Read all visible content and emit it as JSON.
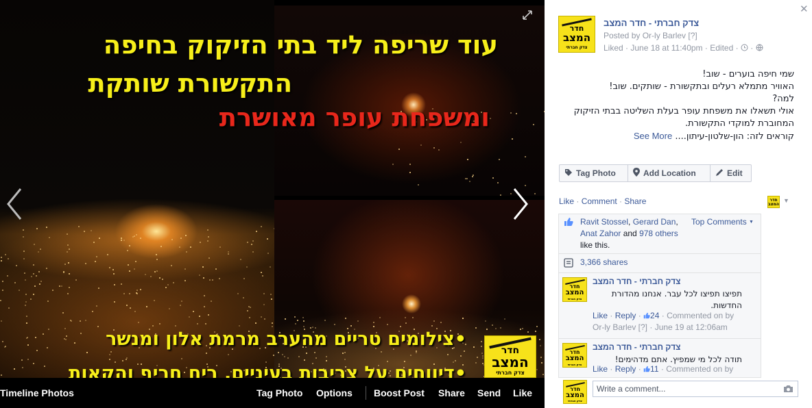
{
  "photo": {
    "overlay_line1": "עוד שריפה ליד בתי הזיקוק בחיפה",
    "overlay_line2": "התקשורת שותקת",
    "overlay_line3": "ומשפחת עופר מאושרת",
    "bullet1": "•צילומים טריים מהערב מרמת אלון ומנשר",
    "bullet2": "•דיווחים על צריבות בעיניים, ריח חריף והקאות",
    "logo_top": "חדר",
    "logo_big": "המצב",
    "logo_small": "צדק חברתי",
    "colors": {
      "headline_yellow": "#f7ef1a",
      "headline_red": "#e8271b",
      "logo_yellow": "#f7e21a"
    }
  },
  "bottom_bar": {
    "timeline_label": "Timeline Photos",
    "tag_photo": "Tag Photo",
    "options": "Options",
    "boost_post": "Boost Post",
    "share": "Share",
    "send": "Send",
    "like": "Like"
  },
  "post": {
    "page_name": "צדק חברתי - חדר המצב",
    "posted_by_prefix": "Posted by ",
    "posted_by_name": "Or-ly Barlev",
    "posted_by_suffix": " [?]",
    "liked": "Liked",
    "date": "June 18 at 11:40pm",
    "edited": "Edited",
    "body_lines": [
      "שמי חיפה בוערים - שוב!",
      "האוויר מתמלא רעלים ובתקשורת - שותקים. שוב!",
      "למה?",
      "אולי תשאלו את משפחת עופר בעלת השליטה בבתי הזיקוק",
      "המחוברת למוקדי התקשורת.",
      "קוראים לזה: הון-שלטון-עיתון...."
    ],
    "see_more": "See More",
    "tag_photo_button": "Tag Photo",
    "add_location_button": "Add Location",
    "edit_button": "Edit"
  },
  "actions": {
    "like": "Like",
    "comment": "Comment",
    "share": "Share",
    "sep": " · "
  },
  "ufi": {
    "liker1": "Ravit Stossel",
    "liker2": "Gerard Dan",
    "liker3": "Anat Zahor",
    "and": " and ",
    "others": "978 others",
    "like_this": " like this.",
    "top_comments": "Top Comments",
    "shares": "3,366 shares"
  },
  "comments": [
    {
      "author": "צדק חברתי - חדר המצב",
      "text": "תפיצו תפיצו לכל עבר. אנחנו מהדורת החדשות.",
      "like": "Like",
      "reply": "Reply",
      "likes_count": "24",
      "commented_on_by": "Commented on by",
      "commenter": "Or-ly Barlev",
      "commenter_suffix": " [?]",
      "date": "June 19 at 12:06am"
    },
    {
      "author": "צדק חברתי - חדר המצב",
      "text": "תודה לכל מי שמפיץ. אתם מדהימים!",
      "like": "Like",
      "reply": "Reply",
      "likes_count": "11",
      "commented_on_by": "Commented on by"
    }
  ],
  "composer": {
    "placeholder": "Write a comment..."
  },
  "icons": {
    "close": "close-icon",
    "expand": "expand-icon",
    "prev": "chevron-left-icon",
    "next": "chevron-right-icon",
    "clock": "clock-icon",
    "globe": "globe-icon",
    "tag": "tag-icon",
    "pin": "location-pin-icon",
    "pencil": "pencil-icon",
    "thumb": "thumbs-up-icon",
    "shares": "shares-icon",
    "camera": "camera-icon"
  },
  "theme": {
    "link_blue": "#3b5998",
    "meta_gray": "#9197a3",
    "ufi_bg": "#f6f7f9"
  }
}
